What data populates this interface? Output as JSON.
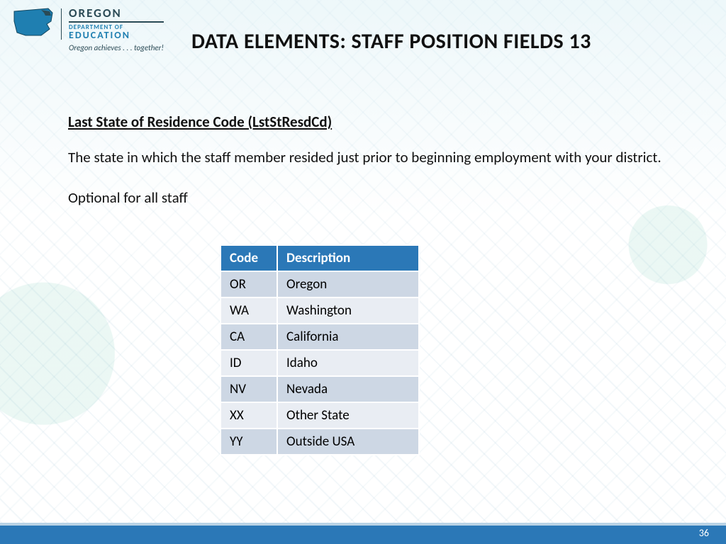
{
  "logo": {
    "state": "OREGON",
    "dept": "DEPARTMENT OF",
    "edu": "EDUCATION",
    "tagline": "Oregon achieves . . . together!"
  },
  "title": "DATA ELEMENTS: STAFF POSITION FIELDS 13",
  "field": {
    "label": "Last State of Residence Code (LstStResdCd)",
    "definition": "The state in which the staff member resided just prior to beginning employment with your district.",
    "rule": "Optional for all staff"
  },
  "table": {
    "headers": {
      "code": "Code",
      "desc": "Description"
    },
    "rows": [
      {
        "code": "OR",
        "desc": "Oregon"
      },
      {
        "code": "WA",
        "desc": "Washington"
      },
      {
        "code": "CA",
        "desc": "California"
      },
      {
        "code": "ID",
        "desc": "Idaho"
      },
      {
        "code": "NV",
        "desc": "Nevada"
      },
      {
        "code": "XX",
        "desc": "Other State"
      },
      {
        "code": "YY",
        "desc": "Outside USA"
      }
    ]
  },
  "page_number": "36"
}
